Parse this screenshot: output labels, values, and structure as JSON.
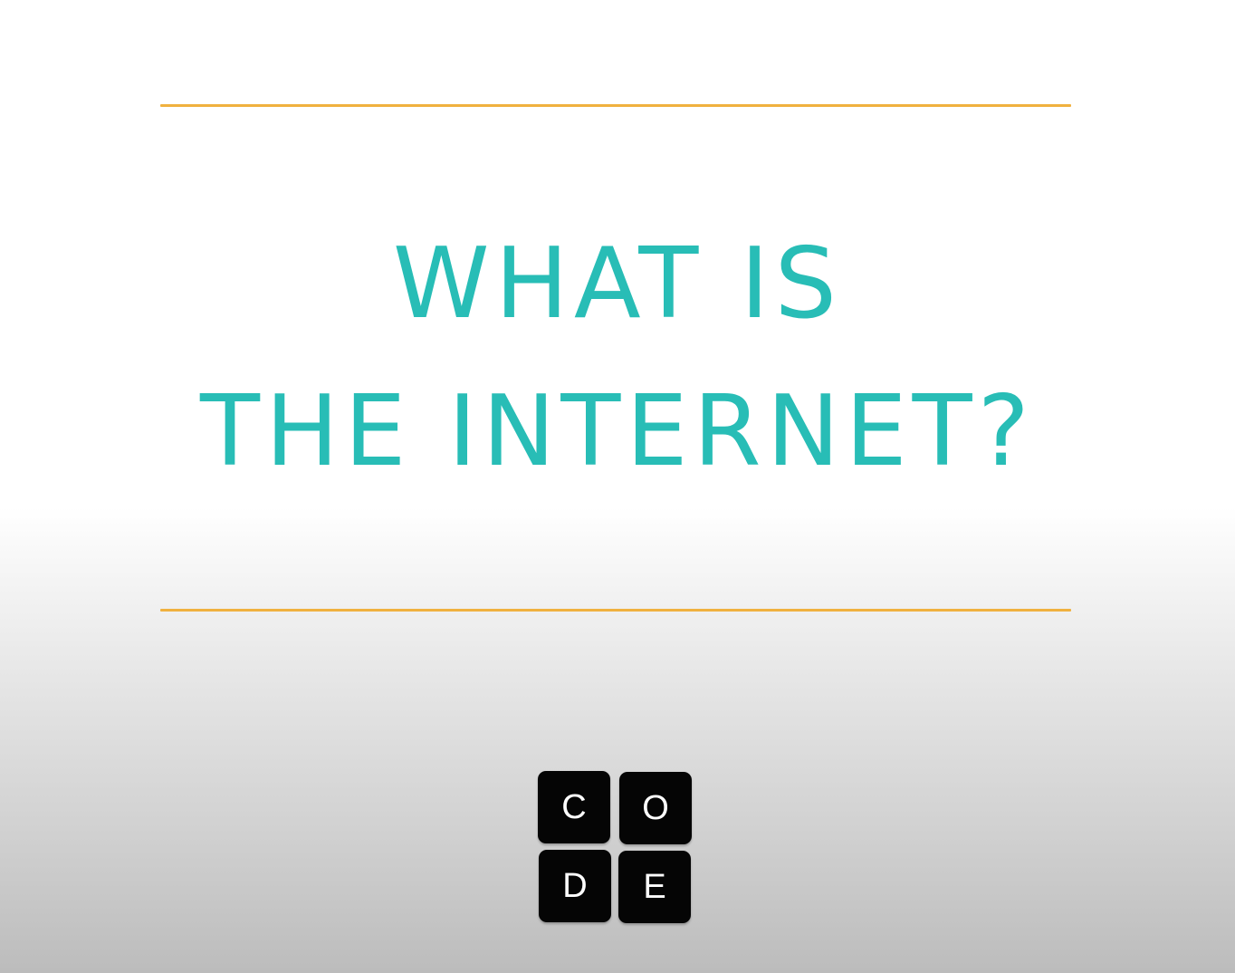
{
  "colors": {
    "rule": "#f0b13f",
    "title": "#28bdb6",
    "logo_tile": "#050505",
    "logo_letter": "#ffffff"
  },
  "title": {
    "line1": "WHAT IS",
    "line2": "THE INTERNET?"
  },
  "logo": {
    "letters": [
      "C",
      "O",
      "D",
      "E"
    ]
  }
}
